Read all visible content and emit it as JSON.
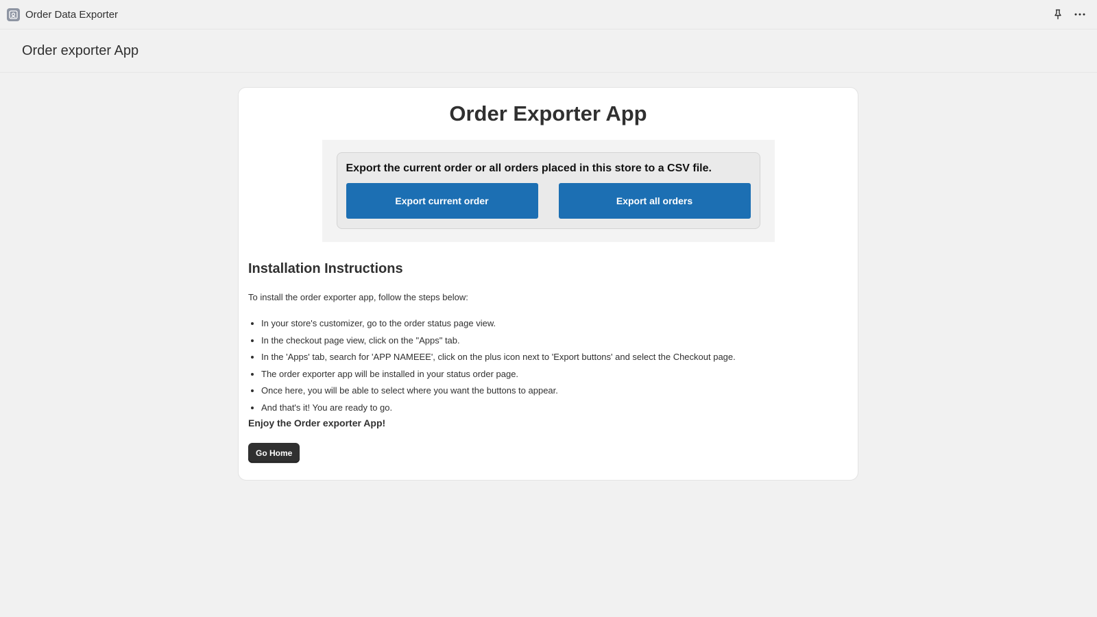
{
  "window": {
    "title": "Order Data Exporter",
    "icons": {
      "app": "app-icon",
      "pin": "pin-icon",
      "more": "more-icon"
    }
  },
  "header": {
    "title": "Order exporter App"
  },
  "card": {
    "heading": "Order Exporter App",
    "export_description": "Export the current order or all orders placed in this store to a CSV file.",
    "export_current_label": "Export current order",
    "export_all_label": "Export all orders",
    "section_heading": "Installation Instructions",
    "intro": "To install the order exporter app, follow the steps below:",
    "steps": [
      "In your store's customizer, go to the order status page view.",
      "In the checkout page view, click on the \"Apps\" tab.",
      "In the 'Apps' tab, search for 'APP NAMEEE', click on the plus icon next to 'Export buttons' and select the Checkout page.",
      "The order exporter app will be installed in your status order page.",
      "Once here, you will be able to select where you want the buttons to appear.",
      "And that's it! You are ready to go."
    ],
    "enjoy": "Enjoy the Order exporter App!",
    "home_label": "Go Home"
  },
  "colors": {
    "primary_button": "#1c6fb3",
    "dark_button": "#303030",
    "background": "#f1f1f1"
  }
}
